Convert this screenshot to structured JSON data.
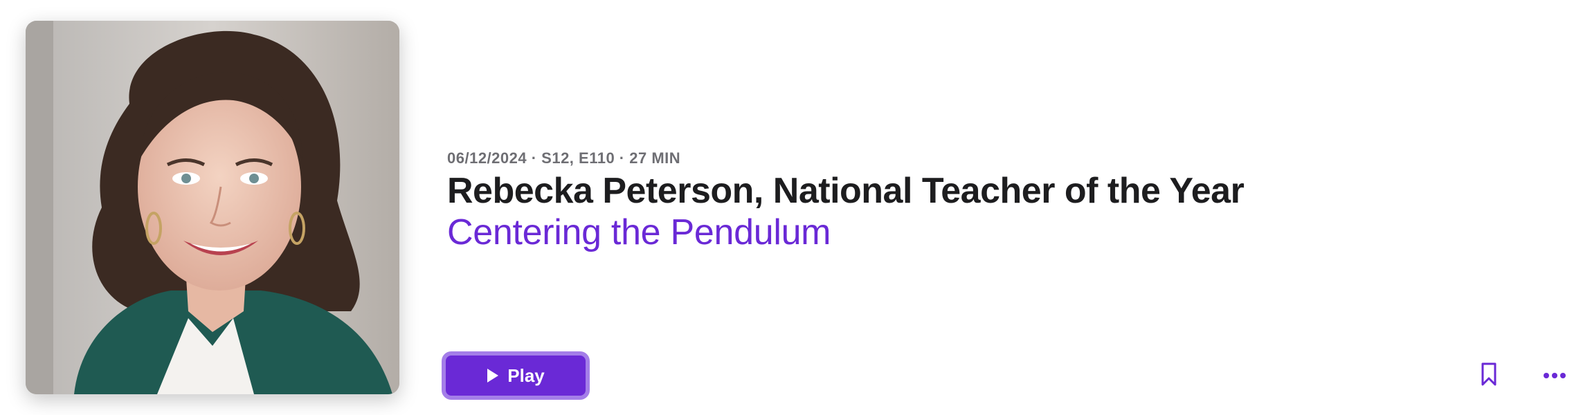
{
  "episode": {
    "meta": "06/12/2024 · S12, E110 · 27 MIN",
    "title": "Rebecka Peterson, National Teacher of the Year",
    "show_title": "Centering the Pendulum",
    "artwork_alt": "Rebecka Peterson"
  },
  "actions": {
    "play_label": "Play",
    "play_icon": "play-icon",
    "bookmark_icon": "bookmark-icon",
    "more_icon": "ellipsis-icon"
  },
  "colors": {
    "accent": "#6a29d6",
    "accent_border": "#a47ee8",
    "title": "#1d1d1f",
    "meta": "#6e6e73"
  }
}
